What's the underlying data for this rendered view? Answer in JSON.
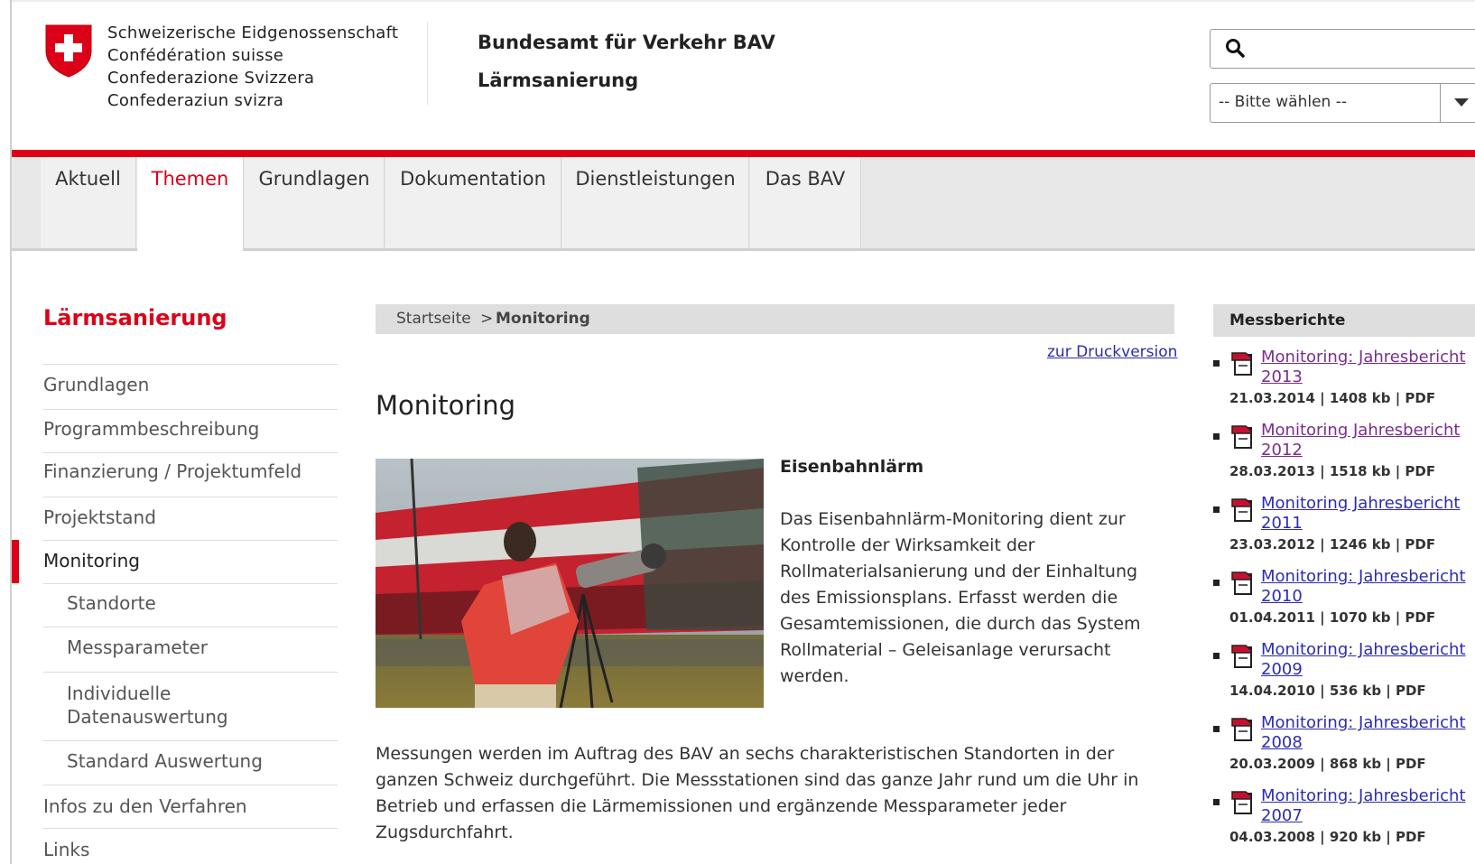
{
  "header": {
    "confederation": [
      "Schweizerische Eidgenossenschaft",
      "Confédération suisse",
      "Confederazione Svizzera",
      "Confederaziun svizra"
    ],
    "office": "Bundesamt für Verkehr BAV",
    "section": "Lärmsanierung",
    "language_select": "-- Bitte wählen --"
  },
  "nav": {
    "tabs": [
      "Aktuell",
      "Themen",
      "Grundlagen",
      "Dokumentation",
      "Dienstleistungen",
      "Das BAV"
    ],
    "active": "Themen"
  },
  "sidebar": {
    "title": "Lärmsanierung",
    "items": [
      "Grundlagen",
      "Programmbeschreibung",
      "Finanzierung / Projektumfeld",
      "Projektstand",
      "Monitoring",
      "Standorte",
      "Messparameter",
      "Individuelle Datenauswertung",
      "Standard Auswertung",
      "Infos zu den Verfahren",
      "Links"
    ],
    "active": "Monitoring"
  },
  "breadcrumb": {
    "home": "Startseite",
    "separator": ">",
    "current": "Monitoring"
  },
  "content": {
    "print_link": "zur Druckversion",
    "title": "Monitoring",
    "subheading": "Eisenbahnlärm",
    "intro": "Das Eisenbahnlärm-Monitoring dient zur Kontrolle der Wirksamkeit der Rollmaterialsanierung und der Einhaltung des Emissionsplans. Erfasst werden die Gesamtemissionen, die durch das System Rollmaterial – Geleisanlage verursacht werden.",
    "body": "Messungen werden im Auftrag des BAV an sechs charakteristischen Standorten in der ganzen Schweiz durchgeführt. Die Messstationen sind das ganze Jahr rund um die Uhr in Betrieb und erfassen die Lärmemissionen und ergänzende Messparameter jeder Zugsdurchfahrt."
  },
  "reports": {
    "heading": "Messberichte",
    "items": [
      {
        "title": "Monitoring: Jahresbericht 2013",
        "meta": "21.03.2014 | 1408 kb | PDF",
        "visited": true
      },
      {
        "title": "Monitoring Jahresbericht 2012",
        "meta": "28.03.2013 | 1518 kb | PDF",
        "visited": true
      },
      {
        "title": "Monitoring Jahresbericht 2011",
        "meta": "23.03.2012 | 1246 kb | PDF",
        "visited": false
      },
      {
        "title": "Monitoring: Jahresbericht 2010",
        "meta": "01.04.2011 | 1070 kb | PDF",
        "visited": false
      },
      {
        "title": "Monitoring: Jahresbericht 2009",
        "meta": "14.04.2010 | 536 kb | PDF",
        "visited": false
      },
      {
        "title": "Monitoring: Jahresbericht 2008",
        "meta": "20.03.2009 | 868 kb | PDF",
        "visited": false
      },
      {
        "title": "Monitoring: Jahresbericht 2007",
        "meta": "04.03.2008 | 920 kb | PDF",
        "visited": false
      }
    ]
  },
  "colors": {
    "brand_red": "#dc0018",
    "link": "#2c2cb0",
    "visited_link": "#7a2e8e"
  },
  "icons": [
    "swiss-crest-icon",
    "search-icon",
    "chevron-down-icon",
    "pdf-icon"
  ]
}
